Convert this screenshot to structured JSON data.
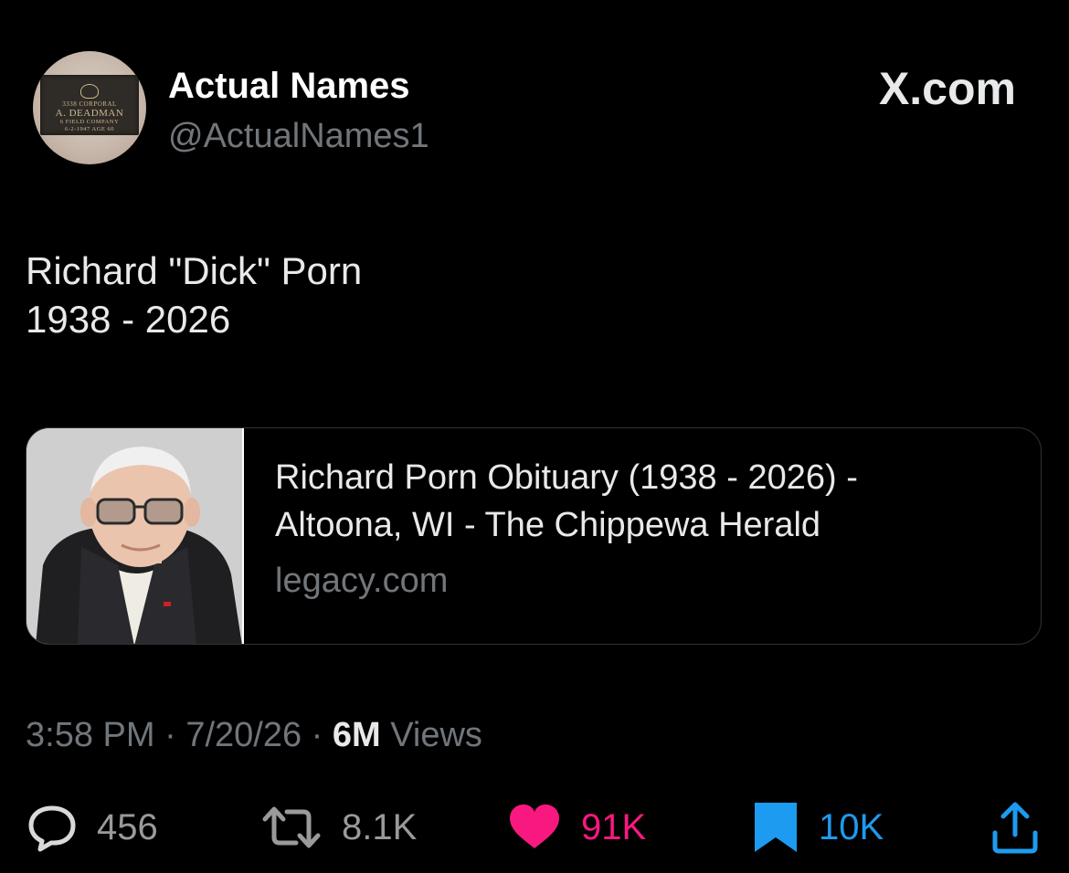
{
  "header": {
    "display_name": "Actual Names",
    "handle": "@ActualNames1",
    "brand": "X.com",
    "avatar_icon": "memorial-plaque-avatar",
    "avatar_plaque_lines": [
      "3338 CORPORAL",
      "A. DEADMAN",
      "6 FIELD COMPANY",
      "6-2-1947 AGE 60"
    ]
  },
  "tweet": {
    "lines": [
      "Richard \"Dick\" Porn",
      "1938 - 2026"
    ]
  },
  "card": {
    "title_lines": [
      "Richard Porn Obituary (1938 - 2026) -",
      "Altoona, WI - The Chippewa Herald"
    ],
    "domain": "legacy.com",
    "thumbnail_icon": "obituary-portrait-photo"
  },
  "meta": {
    "time": "3:58 PM",
    "separator": "·",
    "date": "7/20/26",
    "views_count": "6M",
    "views_label": "Views"
  },
  "actions": {
    "reply": {
      "icon": "reply-icon",
      "count": "456",
      "color": "#71767b"
    },
    "repost": {
      "icon": "repost-icon",
      "count": "8.1K",
      "color": "#71767b"
    },
    "like": {
      "icon": "heart-icon",
      "count": "91K",
      "color": "#f91880"
    },
    "bookmark": {
      "icon": "bookmark-icon",
      "count": "10K",
      "color": "#1d9bf0"
    },
    "share": {
      "icon": "share-icon",
      "color": "#1d9bf0"
    }
  },
  "colors": {
    "background": "#000000",
    "text_primary": "#e7e9ea",
    "text_secondary": "#71767b",
    "border": "#2f3336",
    "like_pink": "#f91880",
    "bookmark_blue": "#1d9bf0"
  }
}
